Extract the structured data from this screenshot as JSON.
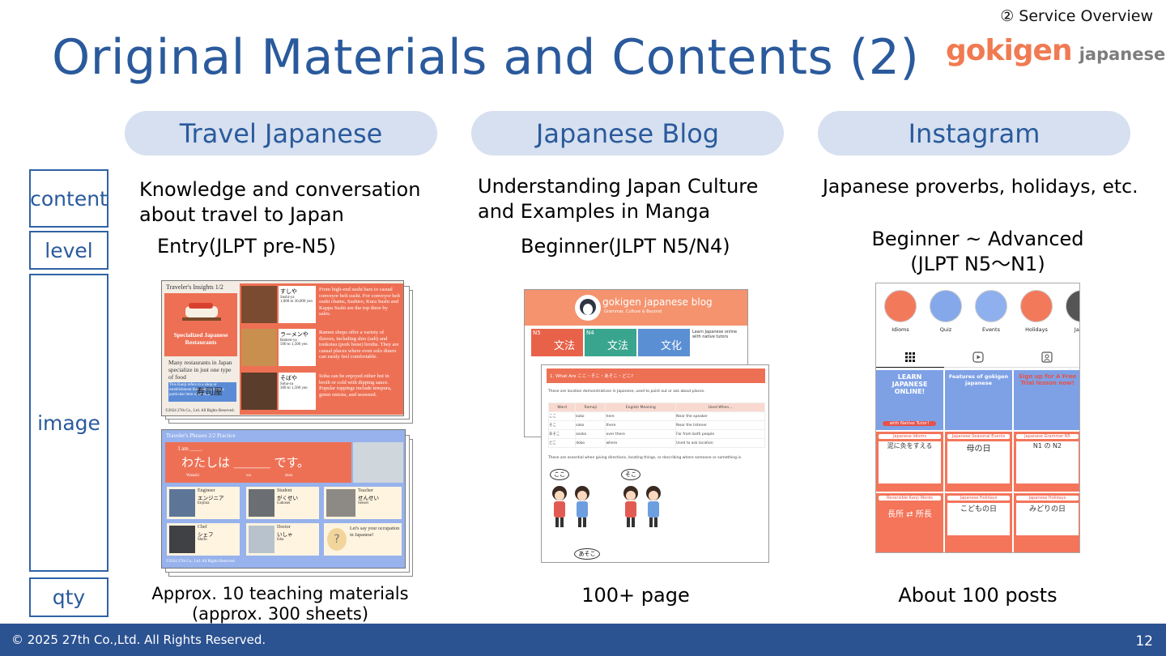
{
  "section_tag": "② Service Overview",
  "title": "Original Materials and Contents (2)",
  "logo": {
    "main": "gokigen",
    "sub": "japanese"
  },
  "columns": [
    {
      "header": "Travel Japanese",
      "content": [
        "Knowledge and conversation",
        "about travel to Japan"
      ],
      "level": "Entry(JLPT pre-N5)",
      "qty": [
        "Approx. 10 teaching materials",
        "(approx. 300 sheets)"
      ]
    },
    {
      "header": "Japanese Blog",
      "content": [
        "Understanding Japan Culture",
        "and Examples in Manga"
      ],
      "level": "Beginner(JLPT N5/N4)",
      "qty": [
        "100+ page"
      ]
    },
    {
      "header": "Instagram",
      "content": [
        "Japanese proverbs, holidays, etc."
      ],
      "level": [
        "Beginner ~ Advanced",
        "(JLPT N5〜N1)"
      ],
      "qty": [
        "About 100 posts"
      ]
    }
  ],
  "row_labels": {
    "content": "content",
    "level": "level",
    "image": "image",
    "qty": "qty"
  },
  "travel_sheet1": {
    "heading": "Traveler's Insights 1/2",
    "badge": "Specialized Japanese Restaurants",
    "intro": "Many restaurants in Japan specialize in just one type of food",
    "kanji_note": "This Kanji refers to a shop or establishment that specializes in a particular item or service.",
    "sushi_kanji": "寿司屋",
    "copyright": "©2024 27th Co., Ltd. All Rights Reserved.",
    "items": [
      {
        "jp": "すしや",
        "romaji": "Sushi-ya",
        "price": "1,000 to 30,000 yen",
        "desc": "From high-end sushi bars to casual conveyor belt sushi. For conveyor belt sushi chains, Sushiro, Kura Sushi and Kappa Sushi are the top three by sales."
      },
      {
        "jp": "ラーメンや",
        "romaji": "Ramen-ya",
        "price": "500 to 1,500 yen",
        "desc": "Ramen shops offer a variety of flavors, including shio (salt) and tonkotsu (pork bone) broths. They are casual places where even solo diners can easily feel comfortable."
      },
      {
        "jp": "そばや",
        "romaji": "Soba-ya",
        "price": "300 to 1,500 yen",
        "desc": "Soba can be enjoyed either hot in broth or cold with dipping sauce. Popular toppings include tempura, green onions, and seaweed."
      }
    ]
  },
  "travel_sheet2": {
    "heading": "Traveler's Phrases 2/2  Practice",
    "lead": "I am ____.",
    "sentence": "わたしは ＿＿＿ です。",
    "romaji": [
      "Watashi",
      "wa",
      "desu"
    ],
    "cards": [
      {
        "en": "Engineer",
        "jp": "エンジニア",
        "romaji": "Enjinia"
      },
      {
        "en": "Student",
        "jp": "がくせい",
        "romaji": "Gakusei"
      },
      {
        "en": "Teacher",
        "jp": "せんせい",
        "romaji": "Sensei"
      },
      {
        "en": "Chef",
        "jp": "シェフ",
        "romaji": "Shefu"
      },
      {
        "en": "Doctor",
        "jp": "いしゃ",
        "romaji": "Isha"
      },
      {
        "en": "Let's say your occupation in Japanese!",
        "jp": "",
        "romaji": ""
      }
    ],
    "copyright": "©2024 27th Co., Ltd. All Rights Reserved."
  },
  "blog": {
    "banner_title": "gokigen japanese blog",
    "banner_sub": "Grammar, Culture & Beyond",
    "tiles": [
      {
        "level": "N5",
        "kanji": "文法",
        "color": "#e8624a"
      },
      {
        "level": "N4",
        "kanji": "文法",
        "color": "#3aa58f"
      },
      {
        "level": "",
        "kanji": "文化",
        "color": "#5b8fd3"
      }
    ],
    "promo": "Learn Japanese online with native tutors",
    "article_heading": "1. What Are ここ・そこ・あそこ・どこ?",
    "article_intro": "These are location demonstratives in Japanese, used to point out or ask about places.",
    "table_headers": [
      "Word",
      "Romaji",
      "English Meaning",
      "Used When..."
    ],
    "table_rows": [
      [
        "ここ",
        "koko",
        "here",
        "Near the speaker"
      ],
      [
        "そこ",
        "soko",
        "there",
        "Near the listener"
      ],
      [
        "あそこ",
        "asoko",
        "over there",
        "Far from both people"
      ],
      [
        "どこ",
        "doko",
        "where",
        "Used to ask location"
      ]
    ],
    "article_note": "These are essential when giving directions, locating things, or describing where someone or something is.",
    "bubbles": [
      "ここ",
      "そこ",
      "あそこ"
    ]
  },
  "insta": {
    "highlights": [
      "Idioms",
      "Quiz",
      "Events",
      "Holidays",
      "Japan"
    ],
    "posts": [
      {
        "title": "LEARN JAPANESE ONLINE!",
        "sub": "with Native Tutor!",
        "bg": "#7ea1e6"
      },
      {
        "title": "Features of gokigen japanese",
        "sub": "",
        "bg": "#7ea1e6"
      },
      {
        "title": "Sign up for A Free Trial lesson now!",
        "sub": "",
        "bg": "#7ea1e6"
      },
      {
        "title": "Japanese Idioms",
        "sub": "泥に灸をすえる",
        "bg": "#f4755a"
      },
      {
        "title": "Japanese Seasonal Events",
        "sub": "母の日",
        "bg": "#f4755a"
      },
      {
        "title": "Japanese Grammar N5",
        "sub": "N1 の N2",
        "bg": "#f4755a"
      },
      {
        "title": "Reversible Kanji Words",
        "sub": "長所 ⇄ 所長",
        "bg": "#f4755a"
      },
      {
        "title": "Japanese Holidays",
        "sub": "こどもの日",
        "bg": "#f4755a"
      },
      {
        "title": "Japanese Holidays",
        "sub": "みどりの日",
        "bg": "#f4755a"
      }
    ]
  },
  "footer": {
    "copyright": "© 2025 27th Co.,Ltd.  All Rights Reserved.",
    "page": "12"
  }
}
